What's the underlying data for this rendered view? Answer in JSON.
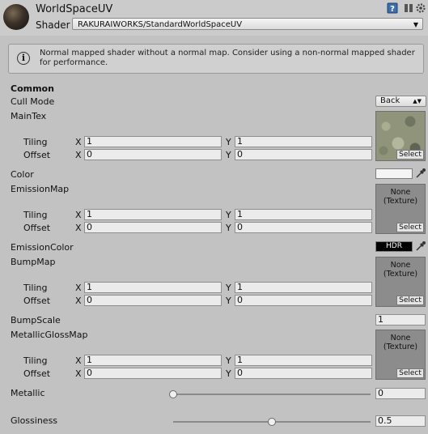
{
  "header": {
    "title": "WorldSpaceUV",
    "shader_label": "Shader",
    "shader_value": "RAKURAIWORKS/StandardWorldSpaceUV"
  },
  "help": {
    "message": "Normal mapped shader without a normal map. Consider using a non-normal mapped shader for performance."
  },
  "section": {
    "common": "Common"
  },
  "cull_mode": {
    "label": "Cull Mode",
    "value": "Back"
  },
  "main_tex": {
    "label": "MainTex",
    "tiling_label": "Tiling",
    "offset_label": "Offset",
    "tiling_x": "1",
    "tiling_y": "1",
    "offset_x": "0",
    "offset_y": "0",
    "select": "Select"
  },
  "color": {
    "label": "Color"
  },
  "emission_map": {
    "label": "EmissionMap",
    "tiling_label": "Tiling",
    "offset_label": "Offset",
    "tiling_x": "1",
    "tiling_y": "1",
    "offset_x": "0",
    "offset_y": "0",
    "none_line1": "None",
    "none_line2": "(Texture)",
    "select": "Select"
  },
  "emission_color": {
    "label": "EmissionColor",
    "hdr": "HDR"
  },
  "bump_map": {
    "label": "BumpMap",
    "tiling_label": "Tiling",
    "offset_label": "Offset",
    "tiling_x": "1",
    "tiling_y": "1",
    "offset_x": "0",
    "offset_y": "0",
    "none_line1": "None",
    "none_line2": "(Texture)",
    "select": "Select"
  },
  "bump_scale": {
    "label": "BumpScale",
    "value": "1"
  },
  "metallic_gloss_map": {
    "label": "MetallicGlossMap",
    "tiling_label": "Tiling",
    "offset_label": "Offset",
    "tiling_x": "1",
    "tiling_y": "1",
    "offset_x": "0",
    "offset_y": "0",
    "none_line1": "None",
    "none_line2": "(Texture)",
    "select": "Select"
  },
  "metallic": {
    "label": "Metallic",
    "value": "0",
    "slider_fraction": 0.0
  },
  "glossiness": {
    "label": "Glossiness",
    "value": "0.5",
    "slider_fraction": 0.5
  },
  "axis": {
    "x": "X",
    "y": "Y"
  },
  "icons": [
    "material-sphere-icon",
    "help-book-icon",
    "settings-gear-icon",
    "info-icon",
    "eyedropper-icon"
  ]
}
